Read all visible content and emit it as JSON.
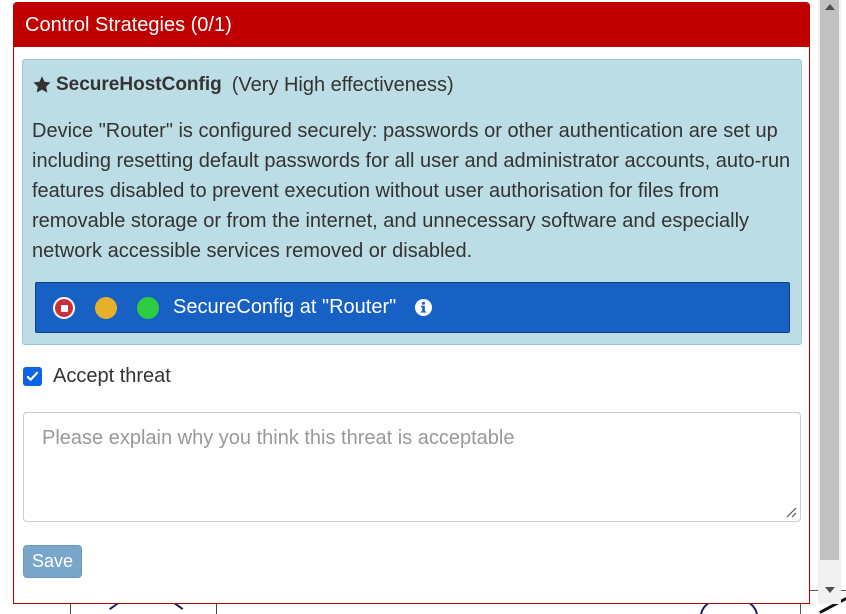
{
  "panel": {
    "header_title": "Control Strategies (0/1)"
  },
  "strategy": {
    "icon": "star-icon",
    "name": "SecureHostConfig",
    "effectiveness": "(Very High effectiveness)",
    "description": "Device \"Router\" is configured securely: passwords or other authentication are set up including resetting default passwords for all user and administrator accounts, auto-run features disabled to prevent execution without user authorisation for files from removable storage or from the internet, and unnecessary software and especially network accessible services removed or disabled.",
    "control": {
      "label": "SecureConfig at \"Router\"",
      "status_dots": [
        "red-stop",
        "amber",
        "green"
      ],
      "info_icon": "info-circle-icon"
    }
  },
  "accept": {
    "checked": true,
    "label": "Accept threat"
  },
  "explain": {
    "placeholder": "Please explain why you think this threat is acceptable"
  },
  "save": {
    "label": "Save"
  },
  "colors": {
    "header": "#c00000",
    "strategy_bg": "#bddde6",
    "control_bar": "#1760c4",
    "checkbox": "#0b63e5",
    "save_btn": "#7aa6cc"
  }
}
